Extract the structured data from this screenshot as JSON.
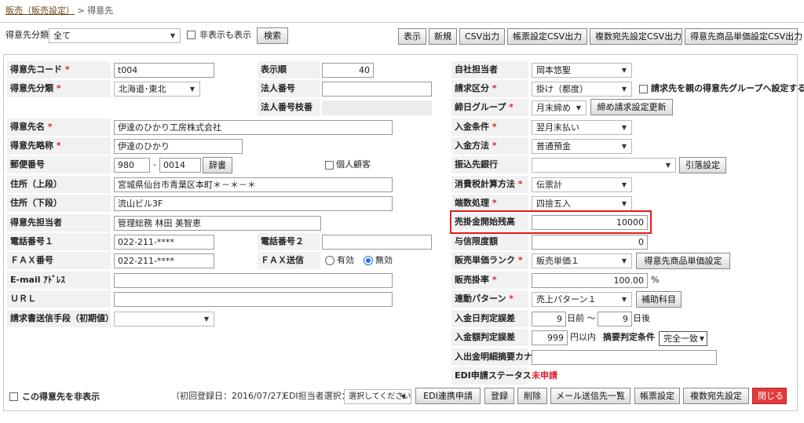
{
  "breadcrumb": {
    "link": "販売（販売設定）",
    "sep": " > ",
    "current": "得意先"
  },
  "filter": {
    "label": "得意先分類",
    "value": "全て",
    "hidden_label": "非表示も表示",
    "search": "検索"
  },
  "toolbar": {
    "show": "表示",
    "new": "新規",
    "csv": "CSV出力",
    "form_csv": "帳票設定CSV出力",
    "multi_csv": "複数宛先設定CSV出力",
    "price_csv": "得意先商品単価設定CSV出力"
  },
  "left": {
    "code_label": "得意先コード",
    "code_value": "t004",
    "cat_label": "得意先分類",
    "cat_value": "北海道･東北",
    "name_label": "得意先名",
    "name_value": "伊達のひかり工房株式会社",
    "short_label": "得意先略称",
    "short_value": "伊達のひかり",
    "zip_label": "郵便番号",
    "zip1": "980",
    "zip_sep": "-",
    "zip2": "0014",
    "dict": "辞書",
    "personal": "個人顧客",
    "addr1_label": "住所（上段）",
    "addr1_value": "宮城県仙台市青葉区本町＊－＊－＊",
    "addr2_label": "住所（下段）",
    "addr2_value": "流山ビル3F",
    "person_label": "得意先担当者",
    "person_value": "管理総務  林田  美智恵",
    "tel1_label": "電話番号１",
    "tel1_value": "022-211-****",
    "fax_label": "ＦＡＸ番号",
    "fax_value": "022-211-****",
    "email_label": "E-mail ｱﾄﾞﾚｽ",
    "url_label": "ＵＲＬ",
    "invoice_label": "請求書送信手段（初期値）"
  },
  "mid": {
    "order_label": "表示順",
    "order_value": "40",
    "corp_label": "法人番号",
    "corpsub_label": "法人番号枝番",
    "tel2_label": "電話番号２",
    "faxsend_label": "ＦＡＸ送信",
    "faxsend_yes": "有効",
    "faxsend_no": "無効"
  },
  "right": {
    "staff_label": "自社担当者",
    "staff_value": "岡本悠聖",
    "billing_label": "請求区分",
    "billing_value": "掛け（都度）",
    "billing_chk": "請求先を親の得意先グループへ設定する",
    "closing_label": "締日グループ",
    "closing_value": "月末締め",
    "closing_btn": "締め請求設定更新",
    "paycond_label": "入金条件",
    "paycond_value": "翌月末払い",
    "paymethod_label": "入金方法",
    "paymethod_value": "普通預金",
    "bank_label": "振込先銀行",
    "bank_btn": "引落設定",
    "tax_label": "消費税計算方法",
    "tax_value": "伝票計",
    "round_label": "端数処理",
    "round_value": "四捨五入",
    "ar_label": "売掛金開始残高",
    "ar_value": "10000",
    "credit_label": "与信限度額",
    "credit_value": "0",
    "rank_label": "販売単価ランク",
    "rank_value": "販売単価１",
    "rank_btn": "得意先商品単価設定",
    "rate_label": "販売掛率",
    "rate_value": "100.00",
    "rate_unit": "%",
    "pattern_label": "連動パターン",
    "pattern_value": "売上パターン１",
    "pattern_btn": "補助科目",
    "dayerr_label": "入金日判定誤差",
    "dayerr_before": "9",
    "dayerr_before_unit": "日前 ～",
    "dayerr_after": "9",
    "dayerr_after_unit": "日後",
    "amterr_label": "入金額判定誤差",
    "amterr_value": "999",
    "amterr_unit": "円以内",
    "summary_label": "摘要判定条件",
    "summary_value": "完全一致",
    "kana_label": "入出金明細摘要カナ",
    "edi_label": "EDI申請ステータス",
    "edi_value": "未申請"
  },
  "footer": {
    "hide_label": "この得意先を非表示",
    "reg": "（初回登録日：2016/07/27）",
    "edi_staff": "EDI担当者選択：",
    "edi_select": "選択してください",
    "edi_apply": "EDI連携申請",
    "register": "登録",
    "delete": "削除",
    "mail": "メール送信先一覧",
    "form": "帳票設定",
    "multi": "複数宛先設定",
    "close": "閉じる"
  },
  "colors": {
    "required": "#e0202a",
    "highlight": "#e31b1b",
    "close_btn": "#e23b3b",
    "radio_on": "#1a73e8",
    "edi_status": "#e0202a"
  }
}
